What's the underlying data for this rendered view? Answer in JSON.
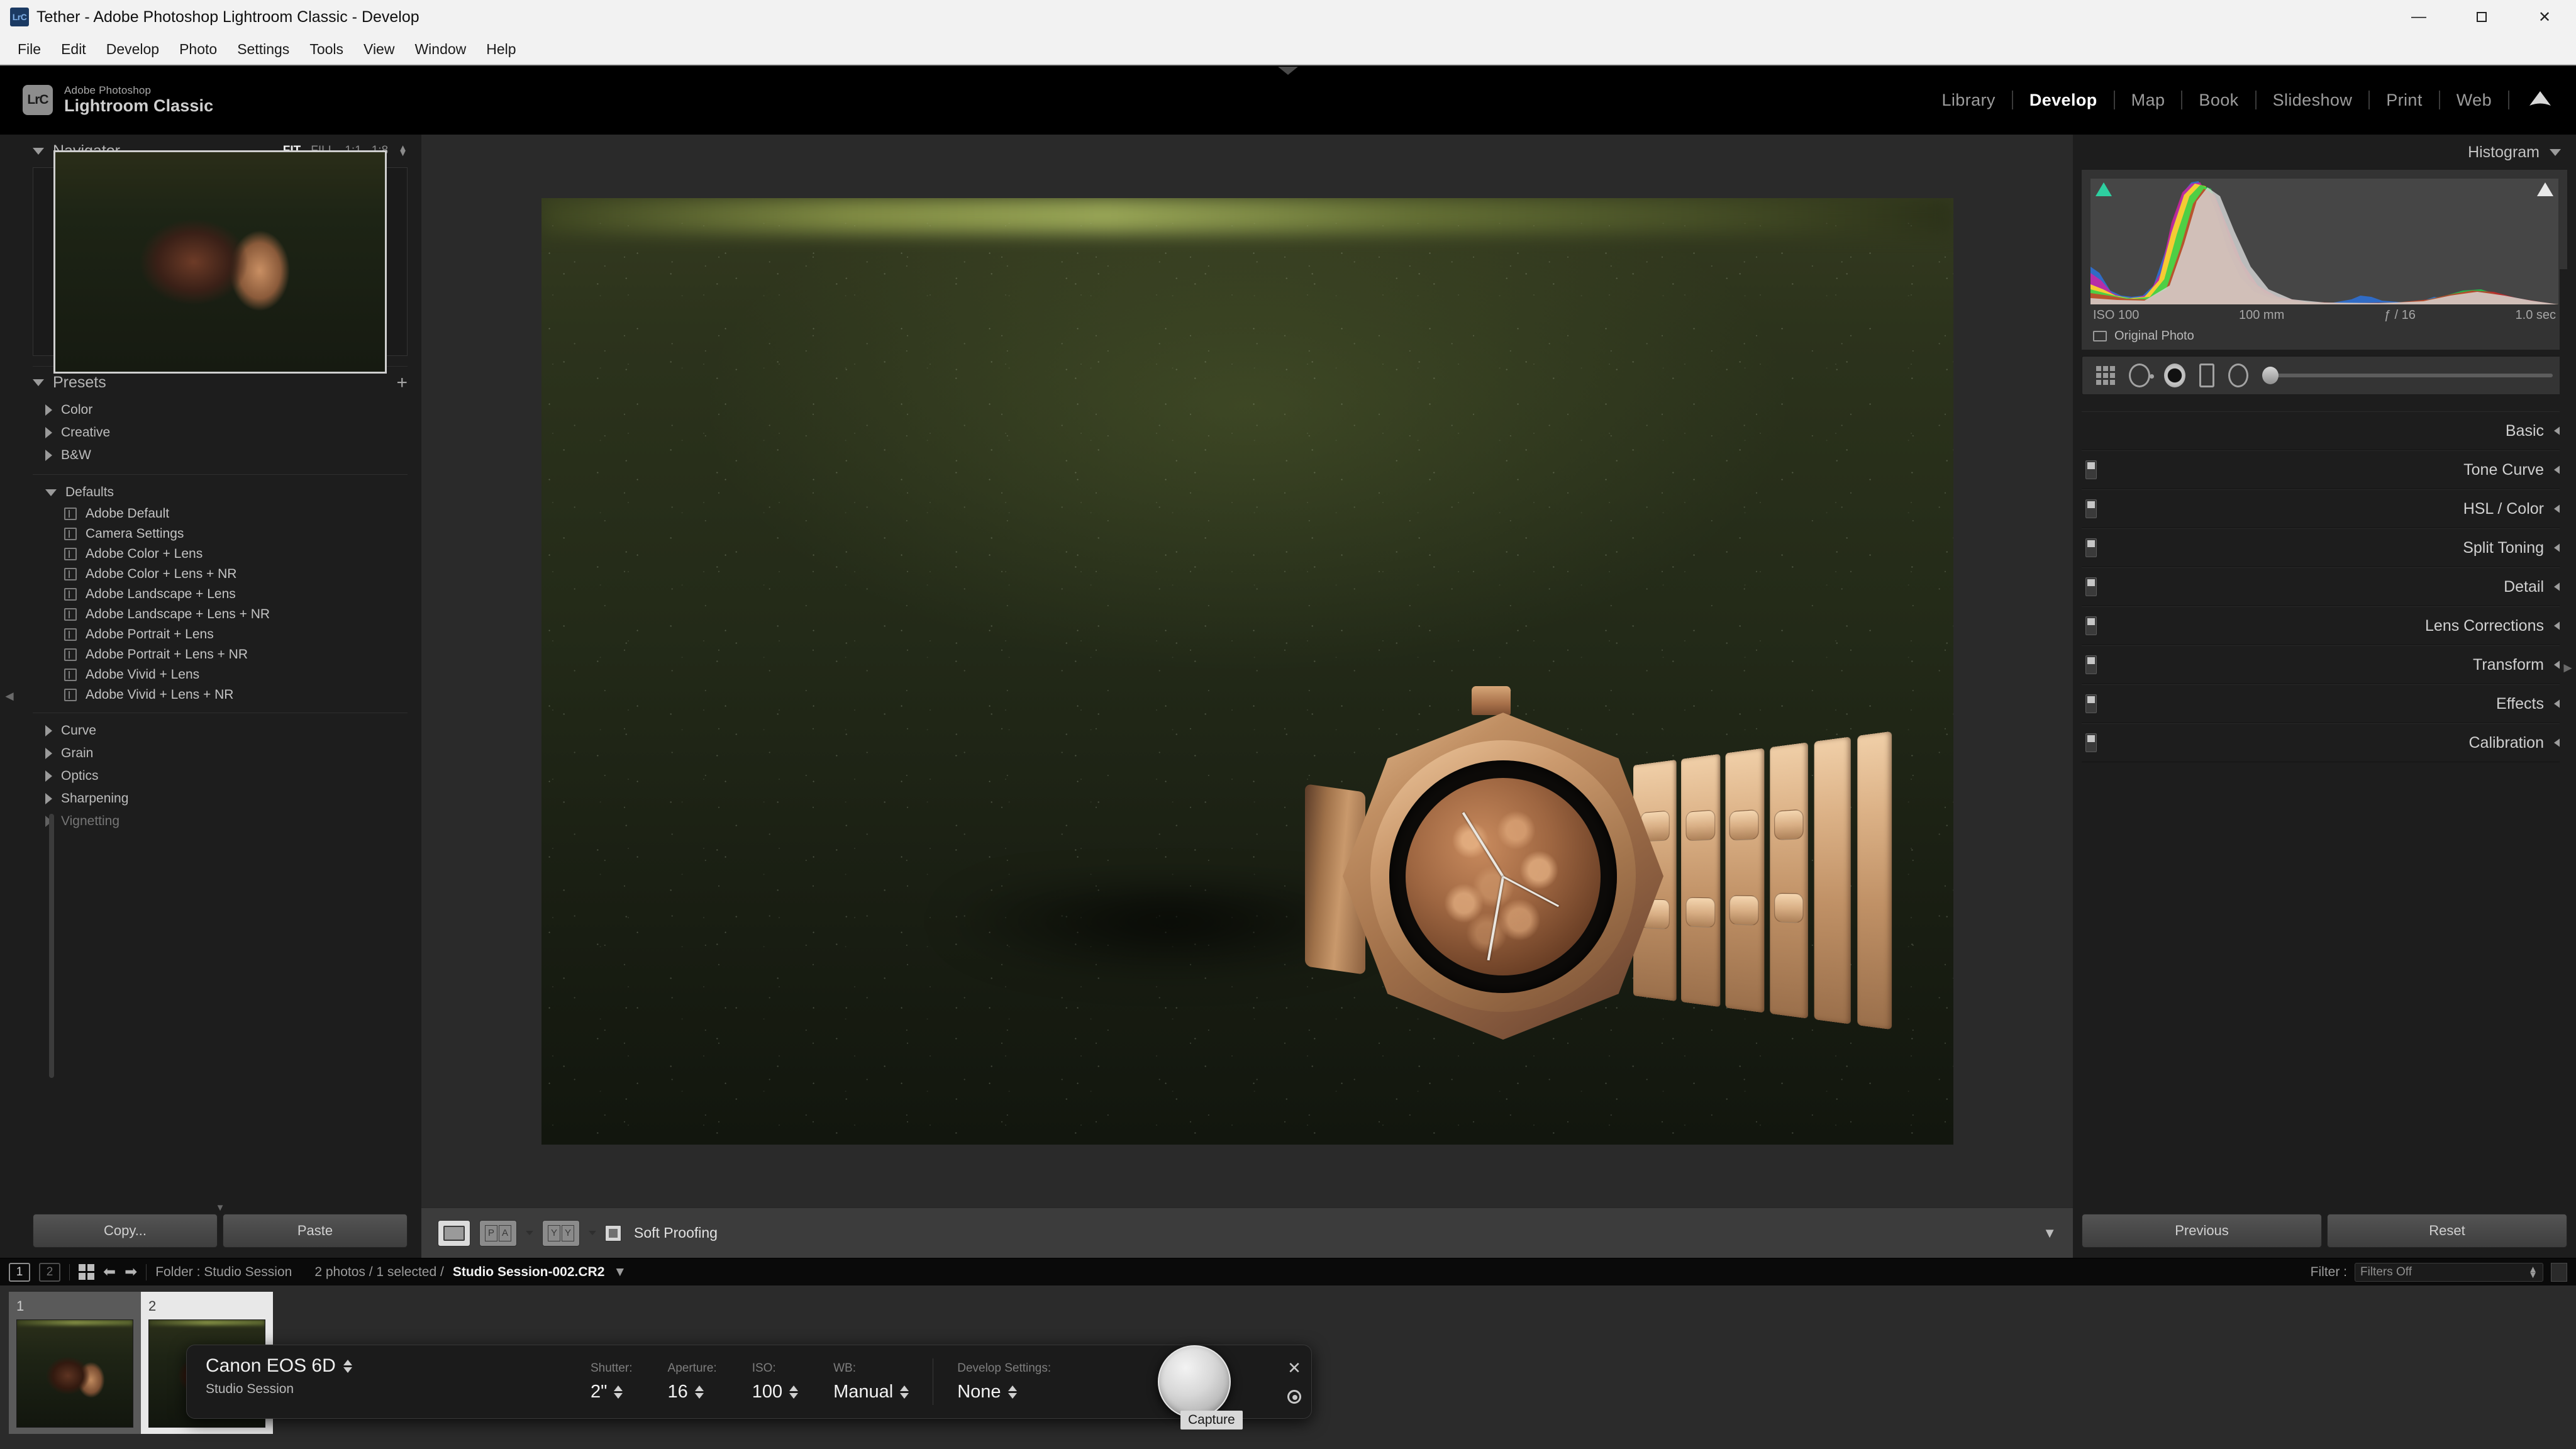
{
  "window": {
    "title": "Tether - Adobe Photoshop Lightroom Classic - Develop",
    "app_icon": "LrC",
    "minimize": "—",
    "maximize": "☐",
    "close": "✕"
  },
  "menubar": {
    "items": [
      "File",
      "Edit",
      "Develop",
      "Photo",
      "Settings",
      "Tools",
      "View",
      "Window",
      "Help"
    ]
  },
  "identity": {
    "badge": "LrC",
    "line1": "Adobe Photoshop",
    "line2": "Lightroom Classic"
  },
  "modules": {
    "items": [
      "Library",
      "Develop",
      "Map",
      "Book",
      "Slideshow",
      "Print",
      "Web"
    ],
    "active": "Develop",
    "cloud_icon": "cloud-icon"
  },
  "navigator": {
    "title": "Navigator",
    "zoom_levels": [
      "FIT",
      "FILL",
      "1:1",
      "1:8"
    ],
    "active_zoom": "FIT"
  },
  "presets": {
    "title": "Presets",
    "add_label": "+",
    "groups_top": [
      "Color",
      "Creative",
      "B&W"
    ],
    "defaults_label": "Defaults",
    "default_items": [
      "Adobe Default",
      "Camera Settings",
      "Adobe Color + Lens",
      "Adobe Color + Lens + NR",
      "Adobe Landscape + Lens",
      "Adobe Landscape + Lens + NR",
      "Adobe Portrait + Lens",
      "Adobe Portrait + Lens + NR",
      "Adobe Vivid + Lens",
      "Adobe Vivid + Lens + NR"
    ],
    "groups_bottom": [
      "Curve",
      "Grain",
      "Optics",
      "Sharpening",
      "Vignetting"
    ]
  },
  "left_buttons": {
    "copy": "Copy...",
    "paste": "Paste"
  },
  "center_toolbar": {
    "soft_proofing_label": "Soft Proofing",
    "soft_proofing_checked": false,
    "loupe_active": true
  },
  "histogram": {
    "title": "Histogram",
    "iso": "ISO 100",
    "focal_length": "100 mm",
    "aperture": "ƒ / 16",
    "shutter": "1.0 sec",
    "original_photo": "Original Photo"
  },
  "right_panel": {
    "sections": [
      "Basic",
      "Tone Curve",
      "HSL / Color",
      "Split Toning",
      "Detail",
      "Lens Corrections",
      "Transform",
      "Effects",
      "Calibration"
    ]
  },
  "right_buttons": {
    "previous": "Previous",
    "reset": "Reset"
  },
  "filmstrip_bar": {
    "screen1": "1",
    "screen2": "2",
    "folder_label": "Folder : Studio Session",
    "selection": "2 photos / 1 selected /",
    "filename": "Studio Session-002.CR2",
    "filter_label": "Filter :",
    "filter_value": "Filters Off"
  },
  "filmstrip": {
    "thumbs": [
      {
        "index": "1",
        "selected": false
      },
      {
        "index": "2",
        "selected": true
      }
    ]
  },
  "tether": {
    "camera": "Canon EOS 6D",
    "session": "Studio Session",
    "fields": [
      {
        "label": "Shutter:",
        "value": "2\""
      },
      {
        "label": "Aperture:",
        "value": "16"
      },
      {
        "label": "ISO:",
        "value": "100"
      },
      {
        "label": "WB:",
        "value": "Manual"
      }
    ],
    "develop_label": "Develop Settings:",
    "develop_value": "None",
    "capture_tooltip": "Capture",
    "close_label": "✕"
  },
  "colors": {
    "panel_bg": "#1d1d1d",
    "work_bg": "#272727",
    "accent_text": "#ffffff",
    "titlebar_bg": "#f2f2f2",
    "clip_green": "#2ecfa0"
  }
}
